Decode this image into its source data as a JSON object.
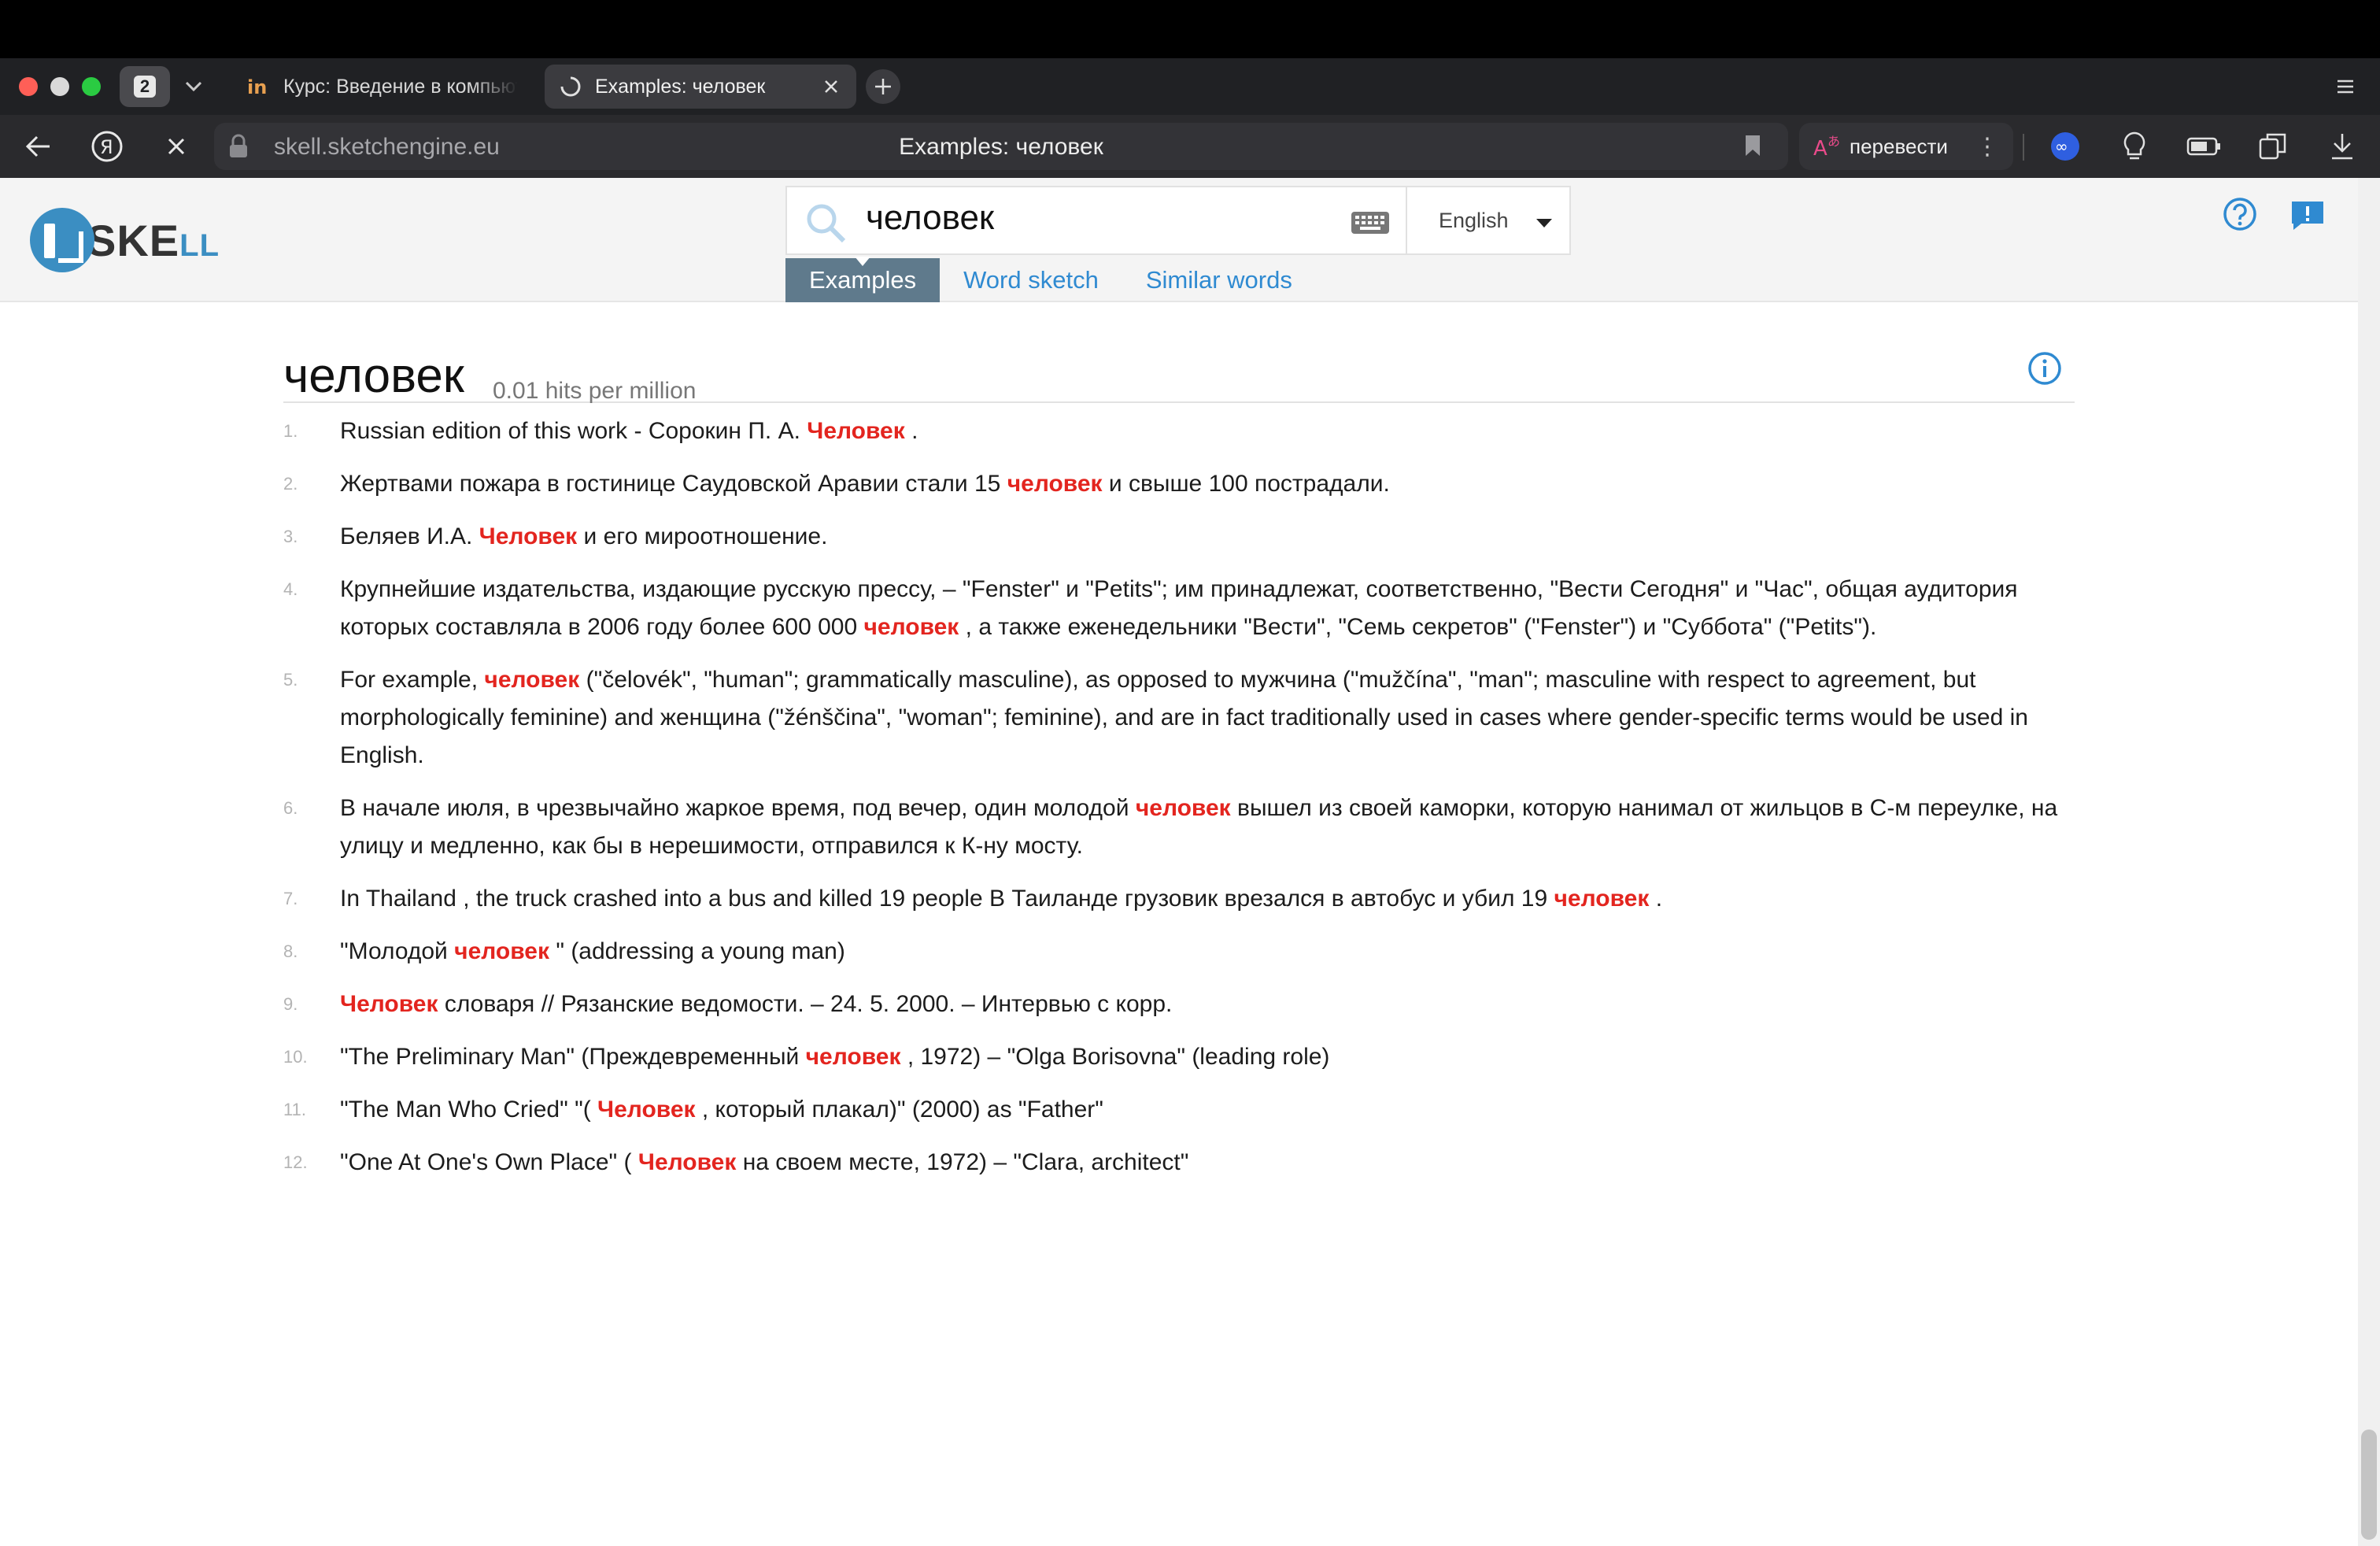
{
  "browser": {
    "tab_count": "2",
    "tabs": [
      {
        "title": "Курс: Введение в компьютерную лингвистику",
        "active": false
      },
      {
        "title": "Examples: человек",
        "active": true
      }
    ],
    "address": {
      "host": "skell.sketchengine.eu",
      "page_title": "Examples: человек"
    },
    "translate_label": "перевести"
  },
  "site": {
    "logo_main": "SKE",
    "logo_suffix": "LL",
    "search": {
      "query": "человек",
      "language": "English"
    },
    "tabs": [
      "Examples",
      "Word sketch",
      "Similar words"
    ],
    "active_tab": "Examples"
  },
  "results": {
    "headword": "человек",
    "frequency": "0.01 hits per million",
    "items": [
      {
        "n": "1.",
        "parts": [
          "Russian edition of this work - Сорокин П. А. ",
          "Человек",
          " ."
        ]
      },
      {
        "n": "2.",
        "parts": [
          "Жертвами пожара в гостинице Саудовской Аравии стали 15 ",
          "человек",
          " и свыше 100 пострадали."
        ]
      },
      {
        "n": "3.",
        "parts": [
          "Беляев И.А. ",
          "Человек",
          " и его мироотношение."
        ]
      },
      {
        "n": "4.",
        "parts": [
          "Крупнейшие издательства, издающие русскую прессу, – \"Fenster\" и \"Petits\"; им принадлежат, соответственно, \"Вести Сегодня\" и \"Час\", общая аудитория которых составляла в 2006 году более 600 000 ",
          "человек",
          " , а также еженедельники \"Вести\", \"Семь секретов\" (\"Fenster\") и \"Суббота\" (\"Petits\")."
        ]
      },
      {
        "n": "5.",
        "parts": [
          "For example, ",
          "человек",
          " (\"čelovék\", \"human\"; grammatically masculine), as opposed to мужчина (\"mužčína\", \"man\"; masculine with respect to agreement, but morphologically feminine) and женщина (\"žénščina\", \"woman\"; feminine), and are in fact traditionally used in cases where gender-specific terms would be used in English."
        ]
      },
      {
        "n": "6.",
        "parts": [
          "В начале июля, в чрезвычайно жаркое время, под вечер, один молодой ",
          "человек",
          " вышел из своей каморки, которую нанимал от жильцов в С-м переулке, на улицу и медленно, как бы в нерешимости, отправился к К-ну мосту."
        ]
      },
      {
        "n": "7.",
        "parts": [
          "In Thailand , the truck crashed into a bus and killed 19 people В Таиланде грузовик врезался в автобус и убил 19 ",
          "человек",
          " ."
        ]
      },
      {
        "n": "8.",
        "parts": [
          "\"Молодой ",
          "человек",
          " \" (addressing a young man)"
        ]
      },
      {
        "n": "9.",
        "parts": [
          "",
          "Человек",
          " словаря // Рязанские ведомости. – 24. 5. 2000. – Интервью с корр."
        ]
      },
      {
        "n": "10.",
        "parts": [
          "\"The Preliminary Man\" (Преждевременный ",
          "человек",
          " , 1972) – \"Olga Borisovna\" (leading role)"
        ]
      },
      {
        "n": "11.",
        "parts": [
          "\"The Man Who Cried\" \"( ",
          "Человек",
          " , который плакал)\" (2000) as \"Father\""
        ]
      },
      {
        "n": "12.",
        "parts": [
          "\"One At One's Own Place\" ( ",
          "Человек",
          " на своем месте, 1972) – \"Clara, architect\""
        ]
      }
    ]
  },
  "colors": {
    "highlight": "#e3251f",
    "link": "#2f8ad1",
    "active_tab": "#5f7a8c",
    "brand": "#3b8ec2"
  }
}
